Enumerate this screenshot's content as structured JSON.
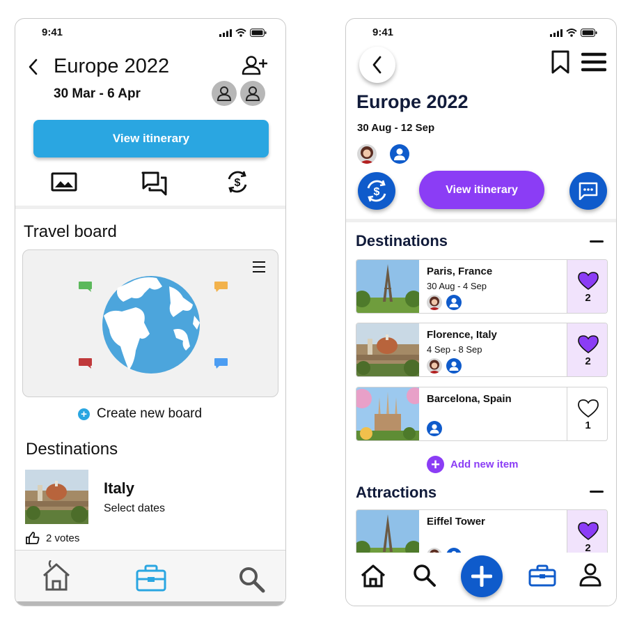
{
  "colors": {
    "accent_blue": "#2aa6e1",
    "accent_purple": "#8b3df5",
    "dark_navy": "#111b3a",
    "circle_blue": "#0f5bcb",
    "liked_bg": "#f1e3fc"
  },
  "left": {
    "status_time": "9:41",
    "title": "Europe 2022",
    "dates": "30 Mar - 6 Apr",
    "view_itinerary": "View itinerary",
    "quick_icons": [
      "photo-gallery-icon",
      "chat-icon",
      "currency-exchange-icon"
    ],
    "travel_board_heading": "Travel board",
    "create_board": "Create new board",
    "destinations_heading": "Destinations",
    "destination": {
      "name": "Italy",
      "subtitle": "Select dates",
      "votes": "2 votes"
    },
    "tabs": [
      "home-icon",
      "suitcase-icon",
      "search-icon"
    ]
  },
  "right": {
    "status_time": "9:41",
    "title": "Europe 2022",
    "dates": "30 Aug - 12 Sep",
    "view_itinerary": "View itinerary",
    "destinations_heading": "Destinations",
    "destinations": [
      {
        "name": "Paris, France",
        "dates": "30 Aug - 4 Sep",
        "votes": "2",
        "liked": true
      },
      {
        "name": "Florence, Italy",
        "dates": "4 Sep - 8 Sep",
        "votes": "2",
        "liked": true
      },
      {
        "name": "Barcelona, Spain",
        "dates": "",
        "votes": "1",
        "liked": false
      }
    ],
    "add_new_item": "Add new item",
    "attractions_heading": "Attractions",
    "attractions": [
      {
        "name": "Eiffel Tower",
        "votes": "2",
        "liked": true
      }
    ],
    "tabs": [
      "home-icon",
      "search-icon",
      "add-icon",
      "suitcase-icon",
      "profile-icon"
    ]
  }
}
